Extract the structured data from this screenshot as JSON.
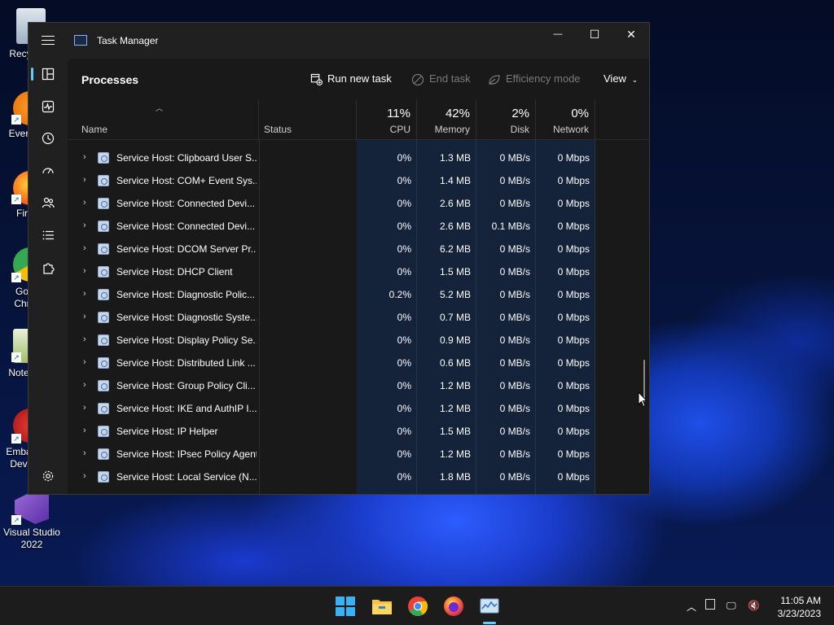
{
  "desktop": {
    "icons": [
      {
        "id": "recycle-bin",
        "label": "Recy"
      },
      {
        "id": "everything",
        "label": "Ever"
      },
      {
        "id": "firefox",
        "label": "Fir"
      },
      {
        "id": "google-chrome",
        "label": "Go\nChr"
      },
      {
        "id": "notepad",
        "label": "Note"
      },
      {
        "id": "embarcadero",
        "label": "Emba\nDev"
      },
      {
        "id": "visual-studio",
        "label": "Visual Studio\n2022"
      }
    ]
  },
  "window": {
    "title": "Task Manager",
    "controls": {
      "minimize": "—",
      "maximize": "☐",
      "close": "✕"
    }
  },
  "toolbar": {
    "page_title": "Processes",
    "run_new_task": "Run new task",
    "end_task": "End task",
    "efficiency_mode": "Efficiency mode",
    "view": "View"
  },
  "columns": {
    "name": "Name",
    "status": "Status",
    "cpu": {
      "label": "CPU",
      "pct": "11%"
    },
    "memory": {
      "label": "Memory",
      "pct": "42%"
    },
    "disk": {
      "label": "Disk",
      "pct": "2%"
    },
    "network": {
      "label": "Network",
      "pct": "0%"
    }
  },
  "processes": [
    {
      "name": "Service Host: Clipboard User S...",
      "status": "",
      "cpu": "0%",
      "memory": "1.3 MB",
      "disk": "0 MB/s",
      "network": "0 Mbps"
    },
    {
      "name": "Service Host: COM+ Event Sys...",
      "status": "",
      "cpu": "0%",
      "memory": "1.4 MB",
      "disk": "0 MB/s",
      "network": "0 Mbps"
    },
    {
      "name": "Service Host: Connected Devi...",
      "status": "",
      "cpu": "0%",
      "memory": "2.6 MB",
      "disk": "0 MB/s",
      "network": "0 Mbps"
    },
    {
      "name": "Service Host: Connected Devi...",
      "status": "",
      "cpu": "0%",
      "memory": "2.6 MB",
      "disk": "0.1 MB/s",
      "network": "0 Mbps"
    },
    {
      "name": "Service Host: DCOM Server Pr...",
      "status": "",
      "cpu": "0%",
      "memory": "6.2 MB",
      "disk": "0 MB/s",
      "network": "0 Mbps"
    },
    {
      "name": "Service Host: DHCP Client",
      "status": "",
      "cpu": "0%",
      "memory": "1.5 MB",
      "disk": "0 MB/s",
      "network": "0 Mbps"
    },
    {
      "name": "Service Host: Diagnostic Polic...",
      "status": "",
      "cpu": "0.2%",
      "memory": "5.2 MB",
      "disk": "0 MB/s",
      "network": "0 Mbps"
    },
    {
      "name": "Service Host: Diagnostic Syste...",
      "status": "",
      "cpu": "0%",
      "memory": "0.7 MB",
      "disk": "0 MB/s",
      "network": "0 Mbps"
    },
    {
      "name": "Service Host: Display Policy Se...",
      "status": "",
      "cpu": "0%",
      "memory": "0.9 MB",
      "disk": "0 MB/s",
      "network": "0 Mbps"
    },
    {
      "name": "Service Host: Distributed Link ...",
      "status": "",
      "cpu": "0%",
      "memory": "0.6 MB",
      "disk": "0 MB/s",
      "network": "0 Mbps"
    },
    {
      "name": "Service Host: Group Policy Cli...",
      "status": "",
      "cpu": "0%",
      "memory": "1.2 MB",
      "disk": "0 MB/s",
      "network": "0 Mbps"
    },
    {
      "name": "Service Host: IKE and AuthIP I...",
      "status": "",
      "cpu": "0%",
      "memory": "1.2 MB",
      "disk": "0 MB/s",
      "network": "0 Mbps"
    },
    {
      "name": "Service Host: IP Helper",
      "status": "",
      "cpu": "0%",
      "memory": "1.5 MB",
      "disk": "0 MB/s",
      "network": "0 Mbps"
    },
    {
      "name": "Service Host: IPsec Policy Agent",
      "status": "",
      "cpu": "0%",
      "memory": "1.2 MB",
      "disk": "0 MB/s",
      "network": "0 Mbps"
    },
    {
      "name": "Service Host: Local Service (N...",
      "status": "",
      "cpu": "0%",
      "memory": "1.8 MB",
      "disk": "0 MB/s",
      "network": "0 Mbps"
    }
  ],
  "taskbar": {
    "apps": [
      "start",
      "file-explorer",
      "chrome",
      "firefox",
      "task-manager"
    ],
    "active_app": "task-manager",
    "time": "11:05 AM",
    "date": "3/23/2023"
  },
  "colors": {
    "accent": "#60cdff",
    "window_bg": "#202020",
    "content_bg": "#191919",
    "highlight_column_bg": "#14223a"
  }
}
